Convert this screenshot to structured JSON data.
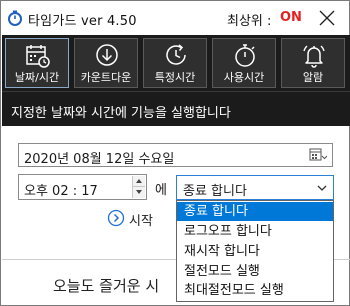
{
  "window": {
    "title": "타임가드 ver 4.50",
    "topmost_label": "최상위 :",
    "topmost_state": "ON",
    "accent_color": "#e52020"
  },
  "toolbar": {
    "items": [
      {
        "label": "날짜/시간",
        "icon": "calendar-clock-icon"
      },
      {
        "label": "카운트다운",
        "icon": "countdown-arrow-icon"
      },
      {
        "label": "특정시간",
        "icon": "refresh-clock-icon"
      },
      {
        "label": "사용시간",
        "icon": "stopwatch-icon"
      },
      {
        "label": "알람",
        "icon": "bell-icon"
      }
    ]
  },
  "info": {
    "message": "지정한 날짜와 시간에 기능을 실행합니다"
  },
  "form": {
    "date_value": "2020년  08월  12일  수요일",
    "time_value": "오후   02 : 17",
    "connector": "에",
    "action_selected": "종료 합니다",
    "action_options": [
      "종료 합니다",
      "로그오프 합니다",
      "재시작 합니다",
      "절전모드 실행",
      "최대절전모드 실행"
    ],
    "start_label": "시작"
  },
  "footer": {
    "text": "오늘도 즐거운 시"
  }
}
